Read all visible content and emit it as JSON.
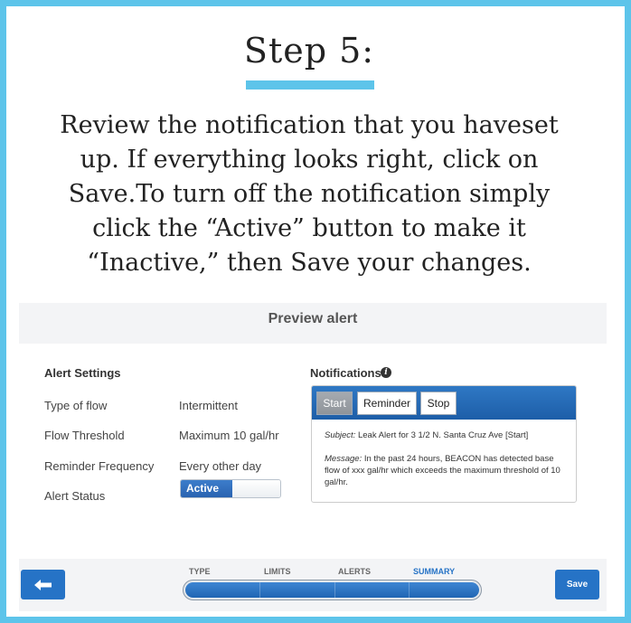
{
  "step_title": "Step 5:",
  "instructions": [
    "Review the notification that you haveset",
    "up. If everything looks right, click on",
    "Save.To turn off the notification simply",
    "click the “Active” button to make it",
    "“Inactive,” then Save your changes."
  ],
  "preview": {
    "title": "Preview alert",
    "settings_title": "Alert Settings",
    "settings": [
      {
        "label": "Type of flow",
        "value": "Intermittent"
      },
      {
        "label": "Flow Threshold",
        "value": "Maximum 10 gal/hr"
      },
      {
        "label": "Reminder Frequency",
        "value": "Every other day"
      },
      {
        "label": "Alert Status",
        "value": ""
      }
    ],
    "status_toggle": {
      "on_label": "Active"
    },
    "notifications_title": "Notifications",
    "notification_tabs": [
      "Start",
      "Reminder",
      "Stop"
    ],
    "active_tab": "Start",
    "subject_label": "Subject:",
    "subject_text": " Leak Alert for 3 1/2 N. Santa Cruz Ave [Start]",
    "message_label": "Message:",
    "message_text": " In the past 24 hours, BEACON has detected base flow of xxx gal/hr which exceeds the maximum threshold of 10 gal/hr."
  },
  "footer": {
    "steps": [
      "TYPE",
      "LIMITS",
      "ALERTS",
      "SUMMARY"
    ],
    "current_step": "SUMMARY",
    "progress_fraction": 1.0,
    "save_label": "Save",
    "back_icon": "arrow-left-icon"
  },
  "colors": {
    "frame": "#5dc4ea",
    "accent": "#2673c6"
  }
}
